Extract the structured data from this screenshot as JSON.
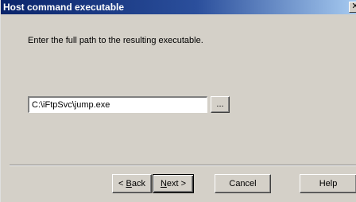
{
  "window": {
    "title": "Host command executable",
    "close_glyph": "✕"
  },
  "content": {
    "instruction": "Enter the full path to the resulting executable.",
    "path_value": "C:\\iFtpSvc\\jump.exe",
    "browse_label": "..."
  },
  "footer": {
    "back": {
      "prefix": "< ",
      "accel": "B",
      "rest": "ack"
    },
    "next": {
      "accel": "N",
      "rest": "ext >"
    },
    "cancel_label": "Cancel",
    "help_label": "Help"
  }
}
